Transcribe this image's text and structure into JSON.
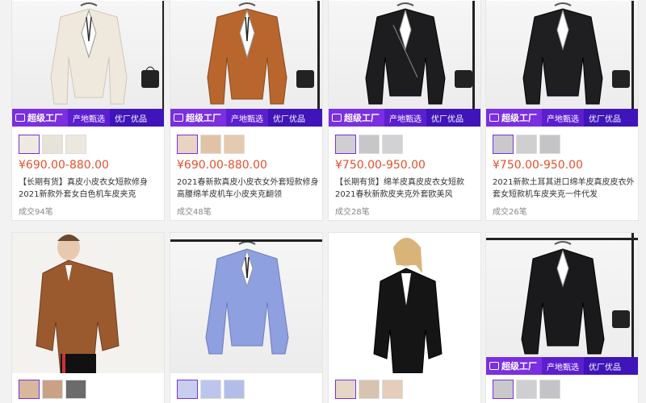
{
  "banner": {
    "factory": "超级工厂",
    "origin": "产地甄选",
    "quality": "优厂优品"
  },
  "products": [
    {
      "price": "¥690.00-880.00",
      "title": "【长期有货】真皮小皮衣女短款修身2021新款外套女白色机车皮夹克",
      "sold": "成交94笔",
      "color": "#efe9dd"
    },
    {
      "price": "¥690.00-880.00",
      "title": "2021春新款真皮小皮衣女外套短款修身高腰绵羊皮机车小皮夹克翻领",
      "sold": "成交48笔",
      "color": "#b8662e"
    },
    {
      "price": "¥750.00-950.00",
      "title": "【长期有货】绵羊皮真皮皮衣女短款2021春秋新款皮夹克外套欧美风",
      "sold": "成交28笔",
      "color": "#1d1d1f"
    },
    {
      "price": "¥750.00-950.00",
      "title": "2021新款土耳其进口绵羊皮真皮皮衣外套女短款机车皮夹克一件代发",
      "sold": "成交26笔",
      "color": "#1f1f22"
    },
    {
      "color": "#9b5a2e"
    },
    {
      "color": "#8ea0df"
    },
    {
      "color": "#151515"
    },
    {
      "color": "#1a1a1c"
    }
  ],
  "icons": {
    "banner": "diamond-icon",
    "hanger": "hanger-icon",
    "bag": "handbag-icon"
  }
}
